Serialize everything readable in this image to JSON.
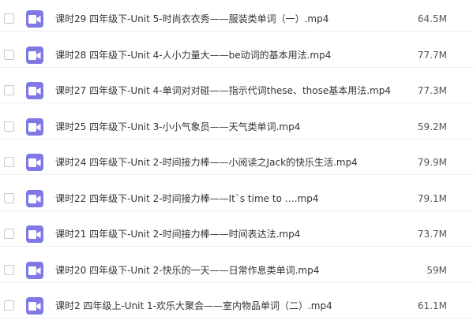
{
  "files": [
    {
      "name": "课时29 四年级下-Unit 5-时尚衣衣秀——服装类单词（一）.mp4",
      "size": "64.5M",
      "icon": "video-file-icon"
    },
    {
      "name": "课时28 四年级下-Unit 4-人小力量大——be动词的基本用法.mp4",
      "size": "77.7M",
      "icon": "video-file-icon"
    },
    {
      "name": "课时27 四年级下-Unit 4-单词对对碰——指示代词these、those基本用法.mp4",
      "size": "77.3M",
      "icon": "video-file-icon"
    },
    {
      "name": "课时25 四年级下-Unit 3-小小气象员——天气类单词.mp4",
      "size": "59.2M",
      "icon": "video-file-icon"
    },
    {
      "name": "课时24 四年级下-Unit 2-时间接力棒——小阅读之Jack的快乐生活.mp4",
      "size": "79.9M",
      "icon": "video-file-icon"
    },
    {
      "name": "课时22 四年级下-Unit 2-时间接力棒——It`s time to ….mp4",
      "size": "79.1M",
      "icon": "video-file-icon"
    },
    {
      "name": "课时21 四年级下-Unit 2-时间接力棒——时间表达法.mp4",
      "size": "73.7M",
      "icon": "video-file-icon"
    },
    {
      "name": "课时20 四年级下-Unit 2-快乐的一天——日常作息类单词.mp4",
      "size": "59M",
      "icon": "video-file-icon"
    },
    {
      "name": "课时2 四年级上-Unit 1-欢乐大聚会——室内物品单词（二）.mp4",
      "size": "61.1M",
      "icon": "video-file-icon"
    }
  ],
  "colors": {
    "icon_bg": "#7f79e6",
    "text": "#333333",
    "divider": "#f0f0f0"
  }
}
